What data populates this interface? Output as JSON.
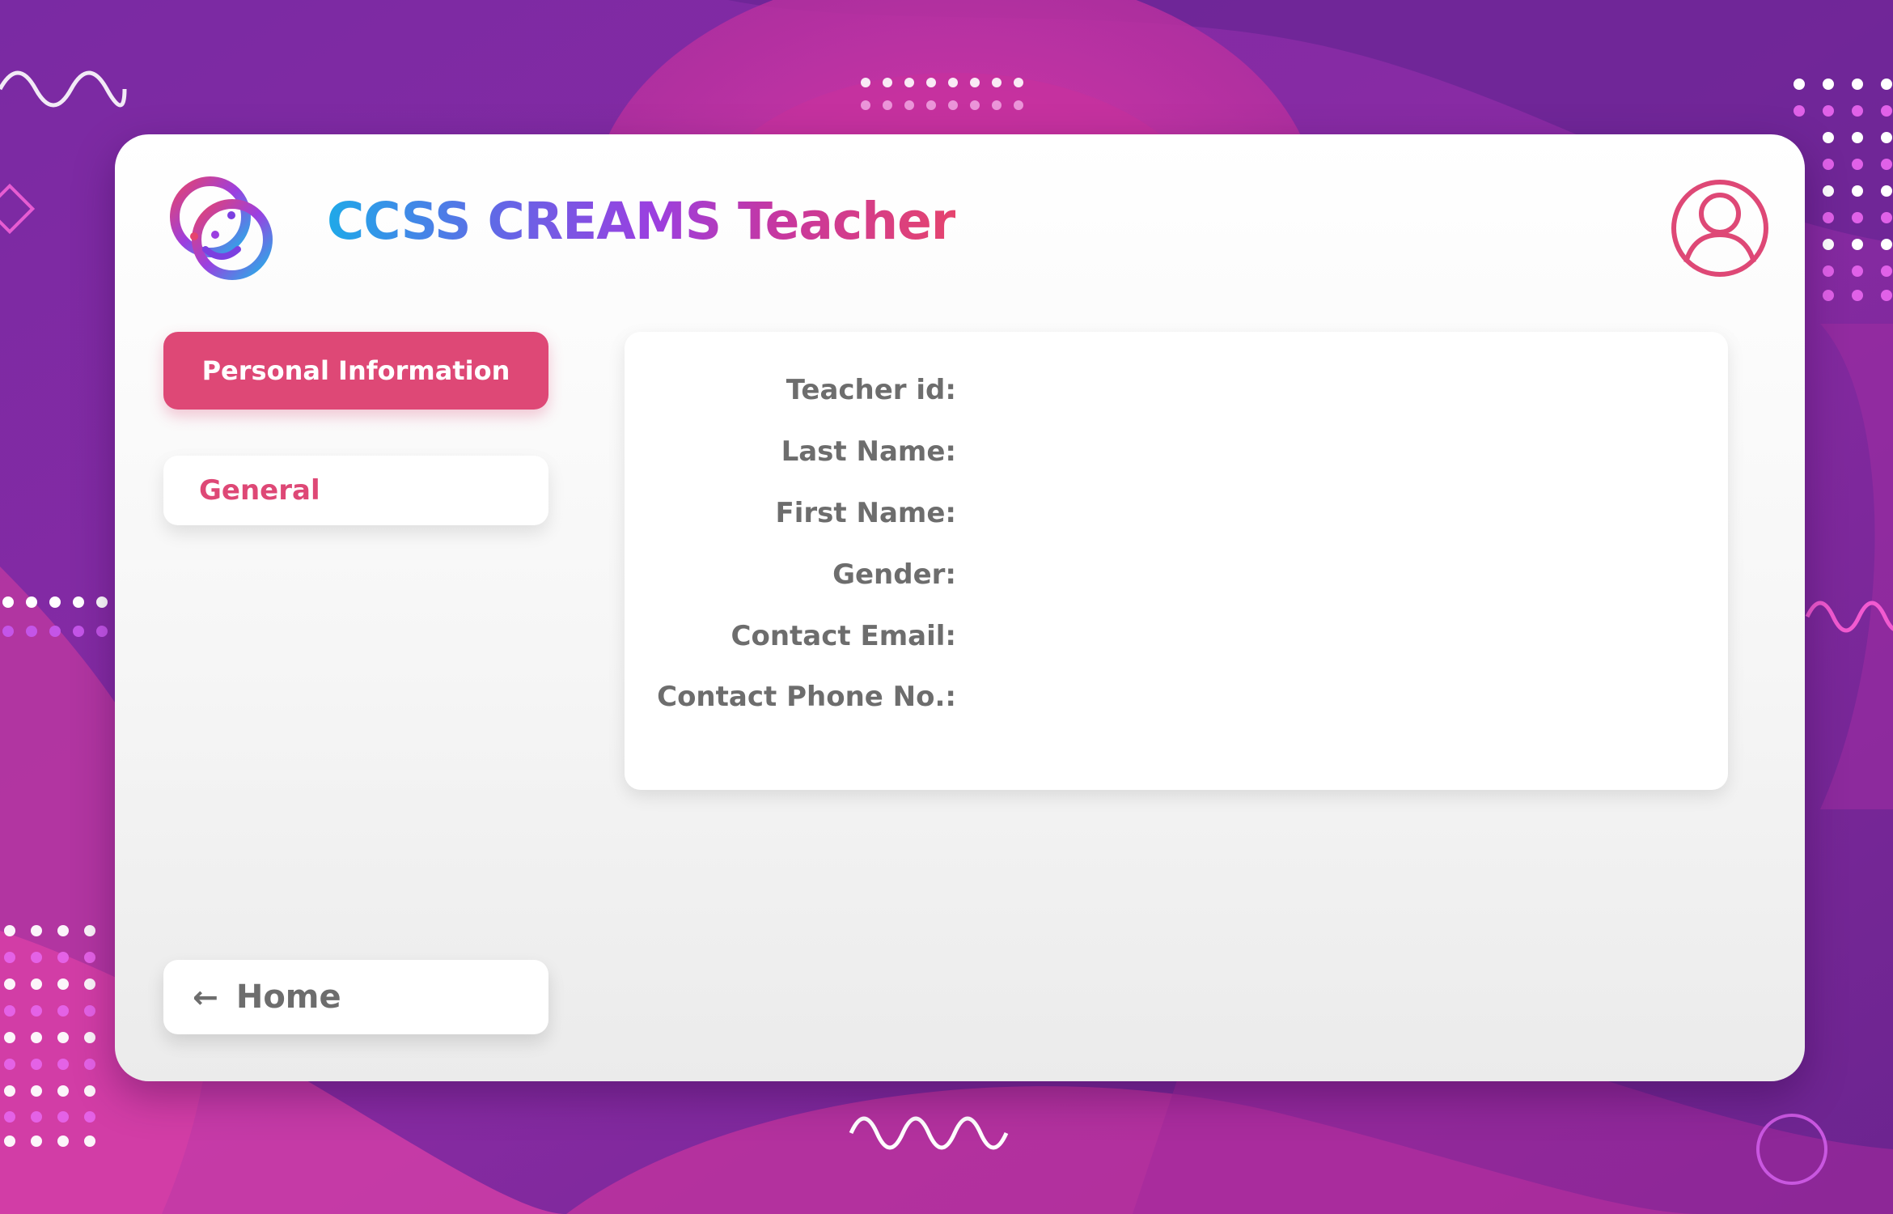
{
  "header": {
    "app_title": "CCSS CREAMS Teacher",
    "logo_icon": "ccss-creams-logo",
    "profile_icon": "user-profile-icon"
  },
  "sidebar": {
    "tabs": [
      {
        "label": "Personal Information",
        "active": true
      },
      {
        "label": "General",
        "active": false
      }
    ],
    "home_button": {
      "label": "Home",
      "icon": "arrow-left-icon"
    }
  },
  "personal_info": {
    "fields": [
      {
        "label": "Teacher id:",
        "value": ""
      },
      {
        "label": "Last Name:",
        "value": ""
      },
      {
        "label": "First Name:",
        "value": ""
      },
      {
        "label": "Gender:",
        "value": ""
      },
      {
        "label": "Contact Email:",
        "value": ""
      },
      {
        "label": "Contact Phone No.:",
        "value": ""
      }
    ]
  },
  "colors": {
    "accent": "#de4876",
    "label_gray": "#6d6d6d",
    "background_purple": "#6a2595",
    "background_magenta": "#d0329f"
  }
}
